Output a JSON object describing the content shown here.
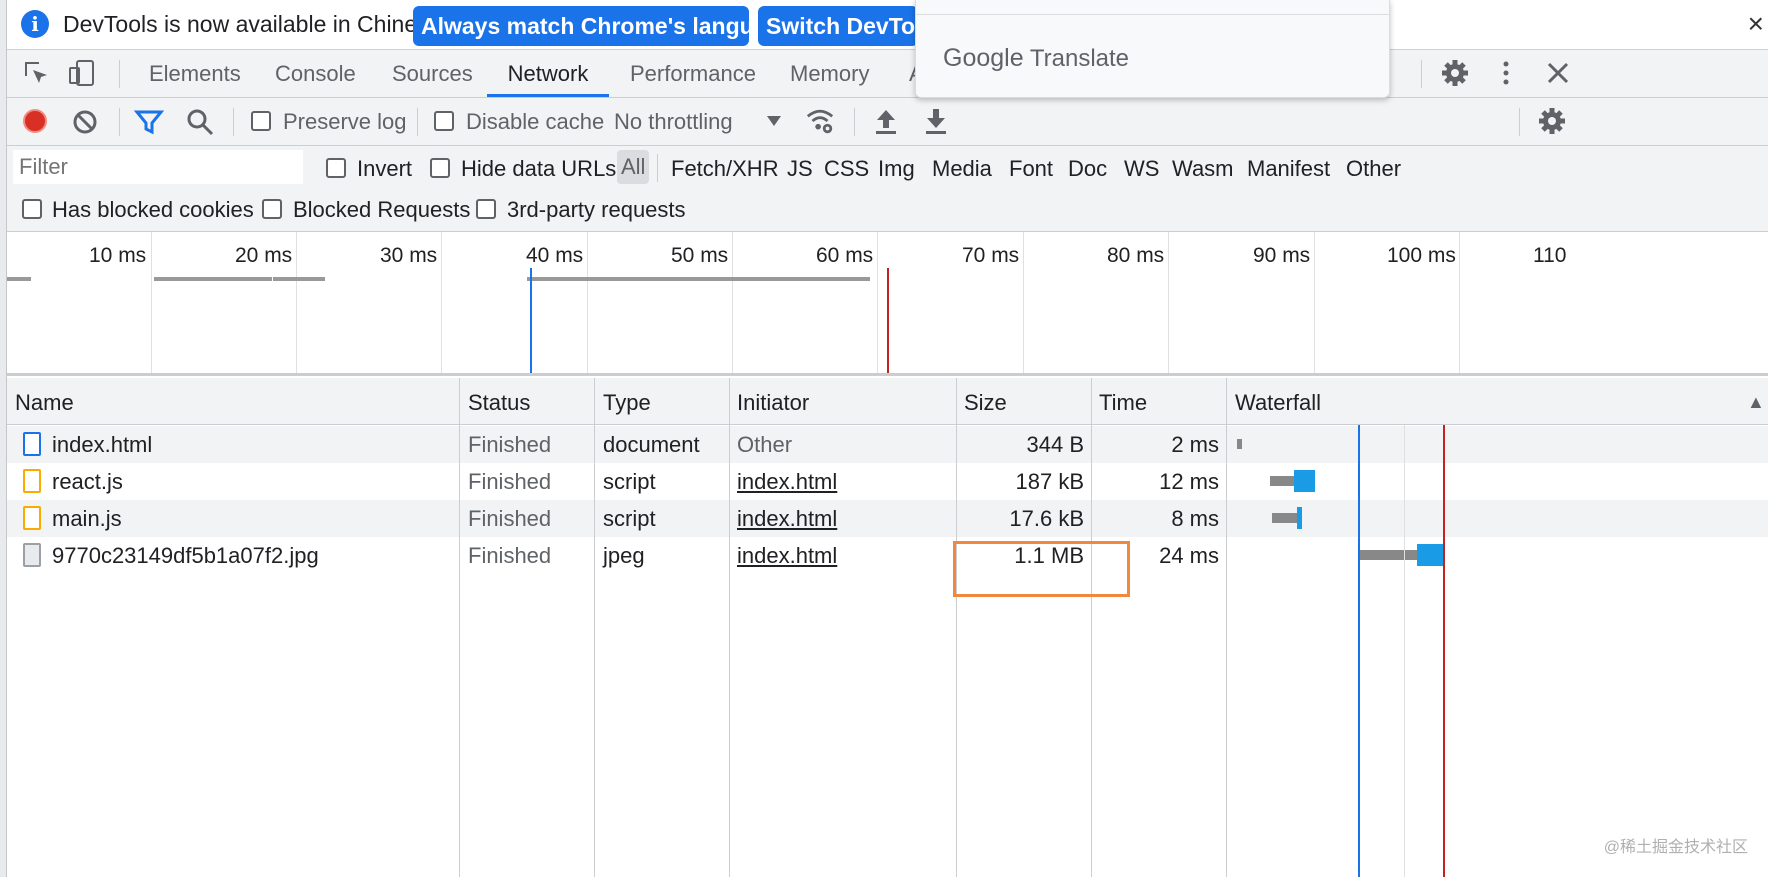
{
  "infobar": {
    "message": "DevTools is now available in Chinese!",
    "btn_match": "Always match Chrome's language",
    "btn_switch": "Switch DevTools",
    "close": "×"
  },
  "translate_popup": {
    "brand_google": "Google",
    "brand_translate": "Translate"
  },
  "tabs": [
    "Elements",
    "Console",
    "Sources",
    "Network",
    "Performance",
    "Memory",
    "A"
  ],
  "active_tab": "Network",
  "toolbar": {
    "preserve_log": "Preserve log",
    "disable_cache": "Disable cache",
    "throttling": "No throttling"
  },
  "filter": {
    "placeholder": "Filter",
    "invert": "Invert",
    "hide_data_urls": "Hide data URLs",
    "types": [
      "All",
      "Fetch/XHR",
      "JS",
      "CSS",
      "Img",
      "Media",
      "Font",
      "Doc",
      "WS",
      "Wasm",
      "Manifest",
      "Other"
    ],
    "has_blocked_cookies": "Has blocked cookies",
    "blocked_requests": "Blocked Requests",
    "third_party": "3rd-party requests"
  },
  "overview": {
    "ticks": [
      "10 ms",
      "20 ms",
      "30 ms",
      "40 ms",
      "50 ms",
      "60 ms",
      "70 ms",
      "80 ms",
      "90 ms",
      "100 ms",
      "110"
    ]
  },
  "table": {
    "headers": [
      "Name",
      "Status",
      "Type",
      "Initiator",
      "Size",
      "Time",
      "Waterfall"
    ],
    "sort_icon": "▲",
    "rows": [
      {
        "name": "index.html",
        "status": "Finished",
        "type": "document",
        "initiator": "Other",
        "size": "344 B",
        "time": "2 ms",
        "icon": "document-icon"
      },
      {
        "name": "react.js",
        "status": "Finished",
        "type": "script",
        "initiator": "index.html",
        "size": "187 kB",
        "time": "12 ms",
        "icon": "script-icon"
      },
      {
        "name": "main.js",
        "status": "Finished",
        "type": "script",
        "initiator": "index.html",
        "size": "17.6 kB",
        "time": "8 ms",
        "icon": "script-icon"
      },
      {
        "name": "9770c23149df5b1a07f2.jpg",
        "status": "Finished",
        "type": "jpeg",
        "initiator": "index.html",
        "size": "1.1 MB",
        "time": "24 ms",
        "icon": "image-icon"
      }
    ]
  },
  "watermark": "@稀土掘金技术社区",
  "colors": {
    "accent": "#1a73e8",
    "record": "#d93025",
    "highlight": "#f0883e",
    "waterfall_block": "#1a9be6"
  }
}
